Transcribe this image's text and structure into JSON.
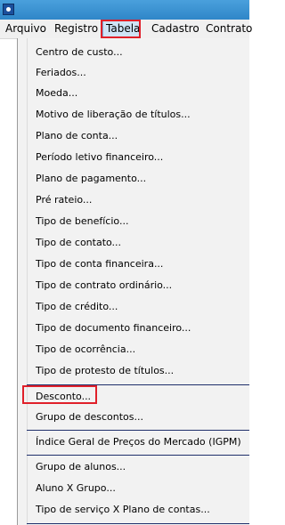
{
  "menubar": {
    "items": [
      "Arquivo",
      "Registro",
      "Tabela",
      "Cadastro",
      "Contrato"
    ]
  },
  "dropdown": {
    "items": [
      "Centro de custo...",
      "Feriados...",
      "Moeda...",
      "Motivo de liberação de títulos...",
      "Plano de conta...",
      "Período letivo financeiro...",
      "Plano de pagamento...",
      "Pré rateio...",
      "Tipo de benefício...",
      "Tipo de contato...",
      "Tipo de conta financeira...",
      "Tipo de contrato ordinário...",
      "Tipo de crédito...",
      "Tipo de documento financeiro...",
      "Tipo de ocorrência...",
      "Tipo de protesto de títulos...",
      "Desconto...",
      "Grupo de descontos...",
      "Índice Geral de Preços do Mercado (IGPM)",
      "Grupo de alunos...",
      "Aluno X Grupo...",
      "Tipo de serviço X Plano de contas..."
    ]
  },
  "colors": {
    "titlebar": "#2f86c8",
    "highlight_box": "#e0202a",
    "active_menu": "#cfe3f6",
    "separator": "#1f2f6b"
  }
}
